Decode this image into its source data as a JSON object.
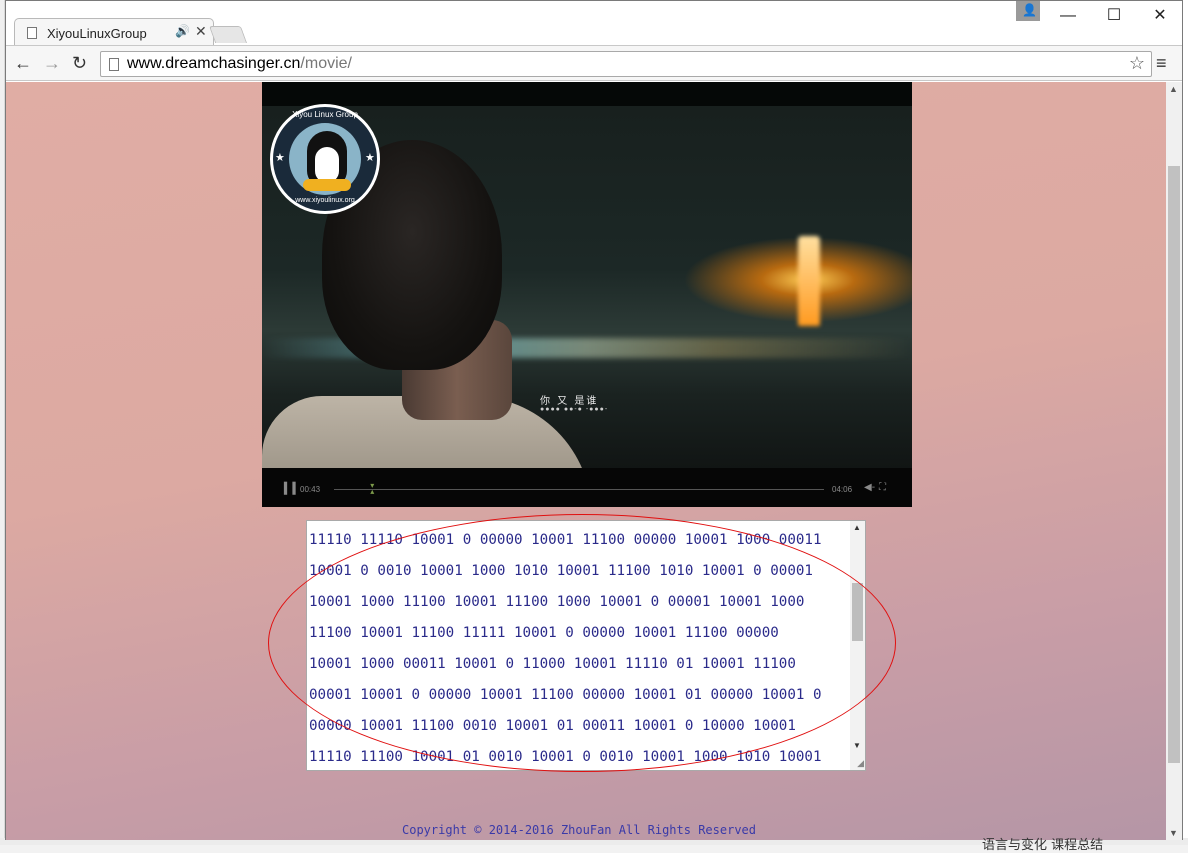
{
  "browser": {
    "tab_title": "XiyouLinuxGroup",
    "audio_icon": "🔊",
    "close_glyph": "✕",
    "url_host": "www.dreamchasinger.cn",
    "url_path": "/movie/",
    "back_icon": "←",
    "forward_icon": "→",
    "reload_icon": "↻",
    "star_icon": "☆",
    "menu_icon": "≡",
    "win_minimize": "—",
    "win_maximize": "☐",
    "win_close": "✕",
    "profile_icon": "👤"
  },
  "video": {
    "logo_top_text": "Xiyou Linux Group",
    "logo_bottom_text": "www.xiyoulinux.org",
    "subtitle": "你   又 是谁",
    "subtitle_dots": "●●●●   ●●-● -●●●-",
    "current_time": "00:43",
    "total_time": "04:06",
    "progress": 0.08,
    "play_icon": "▍▍",
    "volume_icon": "◀-",
    "fullscreen_icon": "⛶"
  },
  "binary_text": [
    "11110 11110 10001 0 00000 10001 11100 00000 10001 1000 00011",
    "10001 0 0010 10001 1000 1010 10001 11100 1010 10001 0 00001",
    "10001 1000 11100 10001 11100 1000 10001 0 00001 10001 1000",
    "11100 10001 11100 11111 10001 0 00000 10001 11100 00000",
    "10001 1000 00011 10001 0 11000 10001 11110 01 10001 11100",
    "00001 10001 0 00000 10001 11100 00000 10001 01 00000 10001 0",
    "00000 10001 11100 0010 10001 01 00011 10001 0 10000 10001",
    "11110 11100 10001 01 0010 10001 0 0010 10001 1000 1010 10001"
  ],
  "footer": "Copyright © 2014-2016 ZhouFan All Rights Reserved",
  "desktop_bottom_text": "语言与变化 课程总结"
}
